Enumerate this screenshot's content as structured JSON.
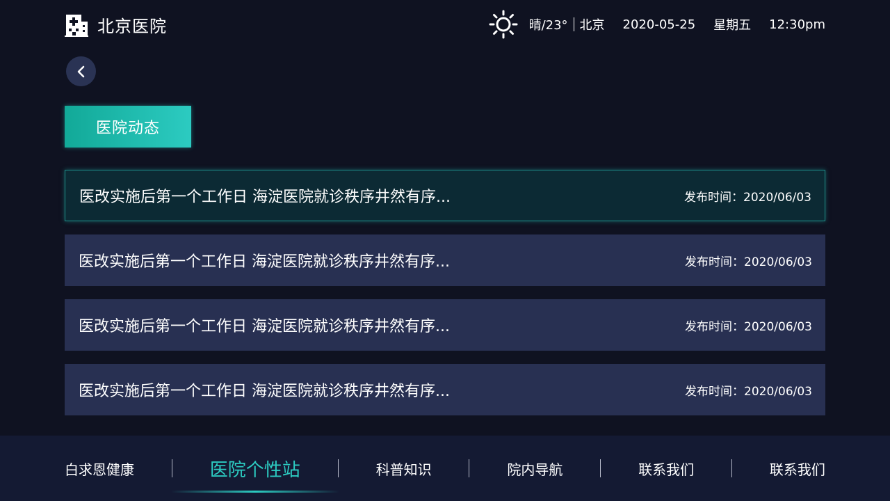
{
  "header": {
    "hospital_name": "北京医院",
    "logo_icon": "hospital-icon",
    "weather": {
      "icon": "sun-icon",
      "text": "晴/23°",
      "city": "北京"
    },
    "date": "2020-05-25",
    "weekday": "星期五",
    "time": "12:30pm"
  },
  "back_button": {
    "icon": "chevron-left-icon"
  },
  "section": {
    "title": "医院动态"
  },
  "news": {
    "items": [
      {
        "title": "医改实施后第一个工作日 海淀医院就诊秩序井然有序...",
        "meta": "发布时间：2020/06/03",
        "active": true
      },
      {
        "title": "医改实施后第一个工作日 海淀医院就诊秩序井然有序...",
        "meta": "发布时间：2020/06/03",
        "active": false
      },
      {
        "title": "医改实施后第一个工作日 海淀医院就诊秩序井然有序...",
        "meta": "发布时间：2020/06/03",
        "active": false
      },
      {
        "title": "医改实施后第一个工作日 海淀医院就诊秩序井然有序...",
        "meta": "发布时间：2020/06/03",
        "active": false
      }
    ]
  },
  "bottom_nav": {
    "items": [
      {
        "label": "白求恩健康",
        "active": false
      },
      {
        "label": "医院个性站",
        "active": true
      },
      {
        "label": "科普知识",
        "active": false
      },
      {
        "label": "院内导航",
        "active": false
      },
      {
        "label": "联系我们",
        "active": false
      },
      {
        "label": "联系我们",
        "active": false
      }
    ]
  },
  "colors": {
    "background": "#0f1221",
    "card": "#283052",
    "card_active": "#0c2a34",
    "accent": "#2ccbc1",
    "nav_bg": "#141a33"
  }
}
